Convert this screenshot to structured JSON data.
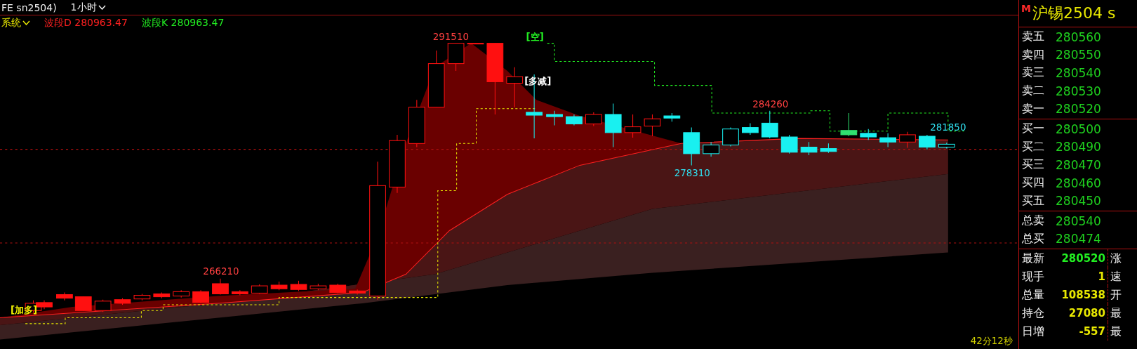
{
  "header": {
    "symbol": "FE sn2504)",
    "period": "1小时"
  },
  "indicator": {
    "system": "系统",
    "lines": [
      {
        "label": "波段D 280963.47",
        "color": "#ff2020"
      },
      {
        "label": "波段K 280963.47",
        "color": "#22ee22"
      }
    ]
  },
  "chart": {
    "price_labels": [
      {
        "text": "291510",
        "kind": "high"
      },
      {
        "text": "266210",
        "kind": "high"
      },
      {
        "text": "284260",
        "kind": "high"
      },
      {
        "text": "278310",
        "kind": "low"
      },
      {
        "text": "281850",
        "kind": "last"
      }
    ],
    "signals": [
      {
        "text": "[空]",
        "kind": "short"
      },
      {
        "text": "[多减]",
        "kind": "reduce"
      },
      {
        "text": "[加多]",
        "kind": "add"
      }
    ],
    "timer": "42分12秒"
  },
  "quote": {
    "badge": "M",
    "title": "沪锡2504 s",
    "asks": [
      {
        "label": "卖五",
        "price": "280560"
      },
      {
        "label": "卖四",
        "price": "280550"
      },
      {
        "label": "卖三",
        "price": "280540"
      },
      {
        "label": "卖二",
        "price": "280530"
      },
      {
        "label": "卖一",
        "price": "280520"
      }
    ],
    "bids": [
      {
        "label": "买一",
        "price": "280500"
      },
      {
        "label": "买二",
        "price": "280490"
      },
      {
        "label": "买三",
        "price": "280470"
      },
      {
        "label": "买四",
        "price": "280460"
      },
      {
        "label": "买五",
        "price": "280450"
      }
    ],
    "totals": [
      {
        "label": "总卖",
        "price": "280540"
      },
      {
        "label": "总买",
        "price": "280474"
      }
    ],
    "stats": [
      {
        "label": "最新",
        "value": "280520",
        "color": "#22ee22",
        "side": "涨"
      },
      {
        "label": "现手",
        "value": "1",
        "color": "#e8e800",
        "side": "速"
      },
      {
        "label": "总量",
        "value": "108538",
        "color": "#e8e800",
        "side": "开"
      },
      {
        "label": "持仓",
        "value": "27080",
        "color": "#e8e800",
        "side": "最"
      },
      {
        "label": "日增",
        "value": "-557",
        "color": "#e8e800",
        "side": "最"
      }
    ]
  }
}
